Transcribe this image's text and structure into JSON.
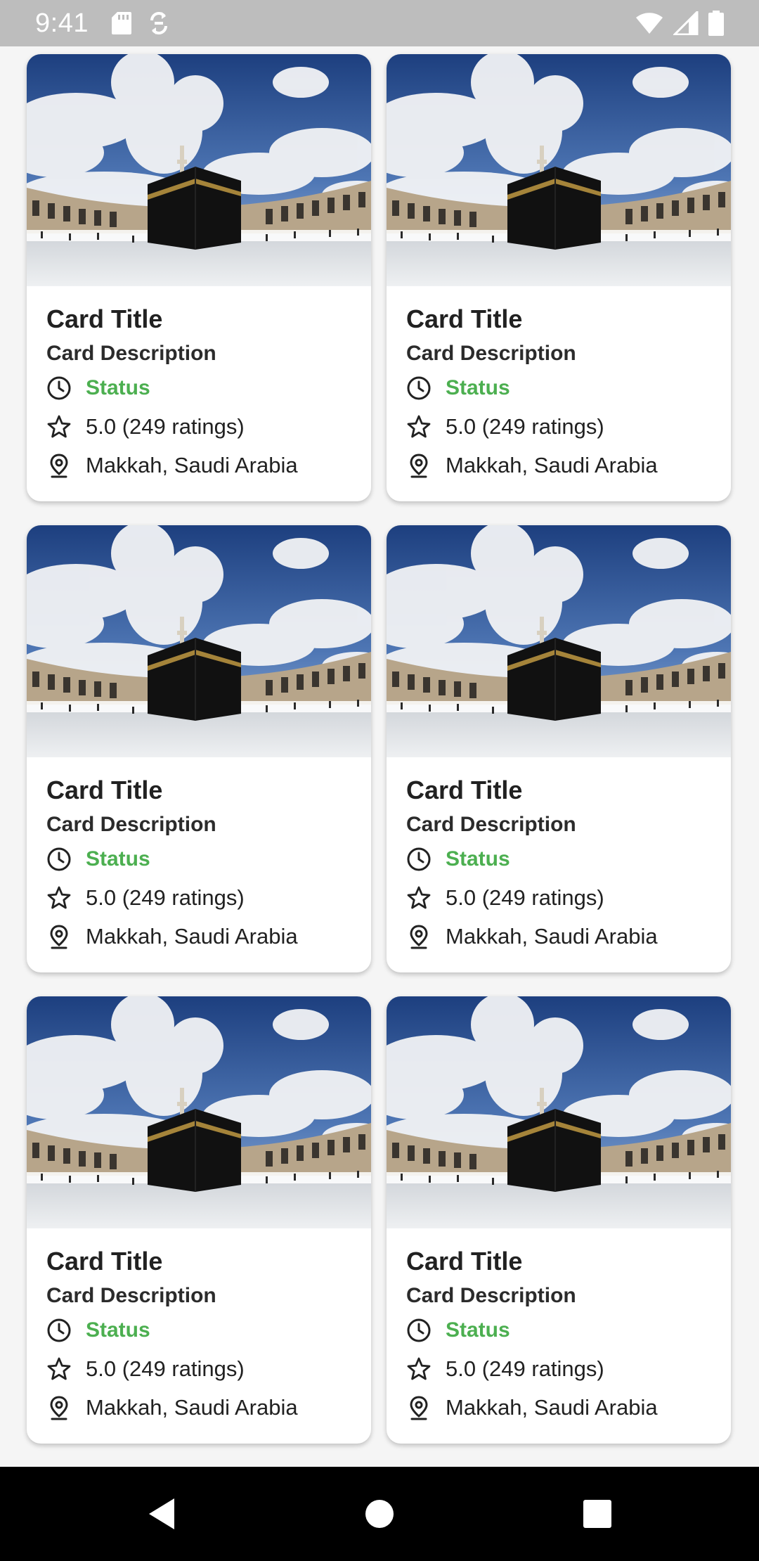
{
  "status_bar": {
    "time": "9:41",
    "icons": [
      "sd-card-icon",
      "sync-icon",
      "wifi-icon",
      "cell-signal-icon",
      "battery-icon"
    ]
  },
  "cards": [
    {
      "title": "Card Title",
      "description": "Card Description",
      "status": "Status",
      "rating": "5.0 (249 ratings)",
      "location": "Makkah, Saudi Arabia"
    },
    {
      "title": "Card Title",
      "description": "Card Description",
      "status": "Status",
      "rating": "5.0 (249 ratings)",
      "location": "Makkah, Saudi Arabia"
    },
    {
      "title": "Card Title",
      "description": "Card Description",
      "status": "Status",
      "rating": "5.0 (249 ratings)",
      "location": "Makkah, Saudi Arabia"
    },
    {
      "title": "Card Title",
      "description": "Card Description",
      "status": "Status",
      "rating": "5.0 (249 ratings)",
      "location": "Makkah, Saudi Arabia"
    },
    {
      "title": "Card Title",
      "description": "Card Description",
      "status": "Status",
      "rating": "5.0 (249 ratings)",
      "location": "Makkah, Saudi Arabia"
    },
    {
      "title": "Card Title",
      "description": "Card Description",
      "status": "Status",
      "rating": "5.0 (249 ratings)",
      "location": "Makkah, Saudi Arabia"
    }
  ],
  "colors": {
    "status_green": "#4caf50",
    "status_bar_bg": "#bdbdbd",
    "nav_bar_bg": "#000000"
  },
  "nav_bar": {
    "icons": [
      "back-icon",
      "home-icon",
      "recents-icon"
    ]
  }
}
